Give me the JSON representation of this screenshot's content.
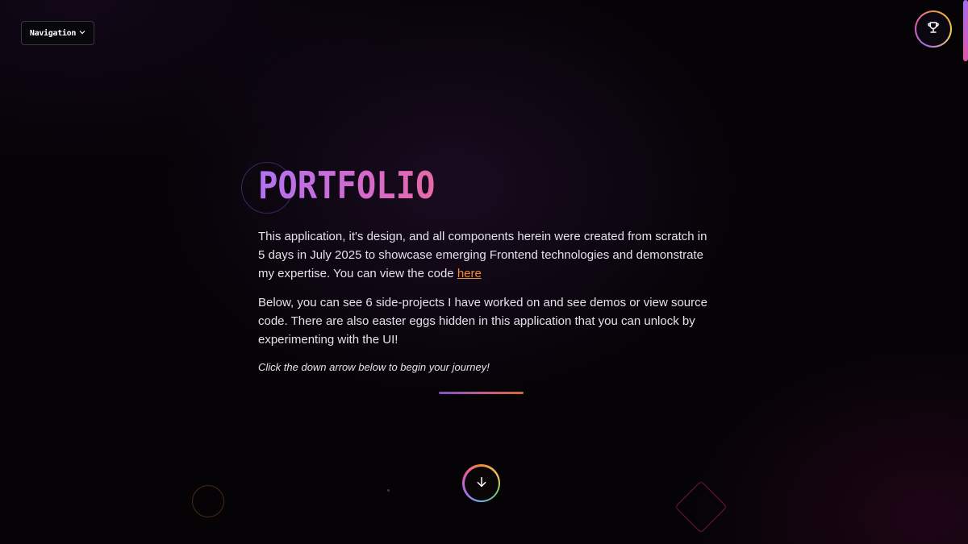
{
  "nav": {
    "label": "Navigation",
    "chevron_icon": "chevron-down-icon"
  },
  "header": {
    "achievements_icon": "trophy-icon"
  },
  "hero": {
    "title": "PORTFOLIO",
    "paragraph_1": "This application, it's design, and all components herein were created from scratch in 5 days in July 2025 to showcase emerging Frontend technologies and demonstrate my expertise. You can view the code ",
    "code_link": "here",
    "paragraph_2": "Below, you can see 6 side-projects I have worked on and see demos or view source code. There are also easter eggs hidden in this application that you can unlock by experimenting with the UI!",
    "hint": "Click the down arrow below to begin your journey!"
  },
  "scroll": {
    "down_icon": "arrow-down-icon"
  },
  "colors": {
    "title_gradient_start": "#b173f2",
    "title_gradient_end": "#e76aa6",
    "link": "#ee8a3a",
    "background": "#060307"
  }
}
